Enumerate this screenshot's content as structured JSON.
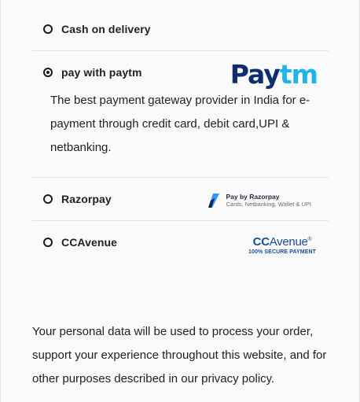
{
  "payment_methods": [
    {
      "label": "Cash on delivery",
      "checked": false
    },
    {
      "label": "pay with paytm",
      "checked": true,
      "logo": {
        "pay": "Pay",
        "tm": "tm"
      },
      "description": "The best payment gateway provider in India for e-payment through credit card, debit card,UPI & netbanking."
    },
    {
      "label": "Razorpay",
      "checked": false,
      "logo": {
        "title": "Pay by Razorpay",
        "subtitle": "Cards, Netbanking, Wallet & UPI"
      }
    },
    {
      "label": "CCAvenue",
      "checked": false,
      "logo": {
        "cc": "CC",
        "avenue": "Avenue",
        "mark": "®",
        "tagline": "100% SECURE PAYMENT"
      }
    }
  ],
  "privacy_text": "Your personal data will be used to process your order, support your experience throughout this website, and for other purposes described in our privacy policy.",
  "colors": {
    "paytm_dark": "#0d2e6e",
    "paytm_light": "#20b3ee",
    "ccavenue_blue": "#1c4d99",
    "divider": "#e2e2e2"
  }
}
